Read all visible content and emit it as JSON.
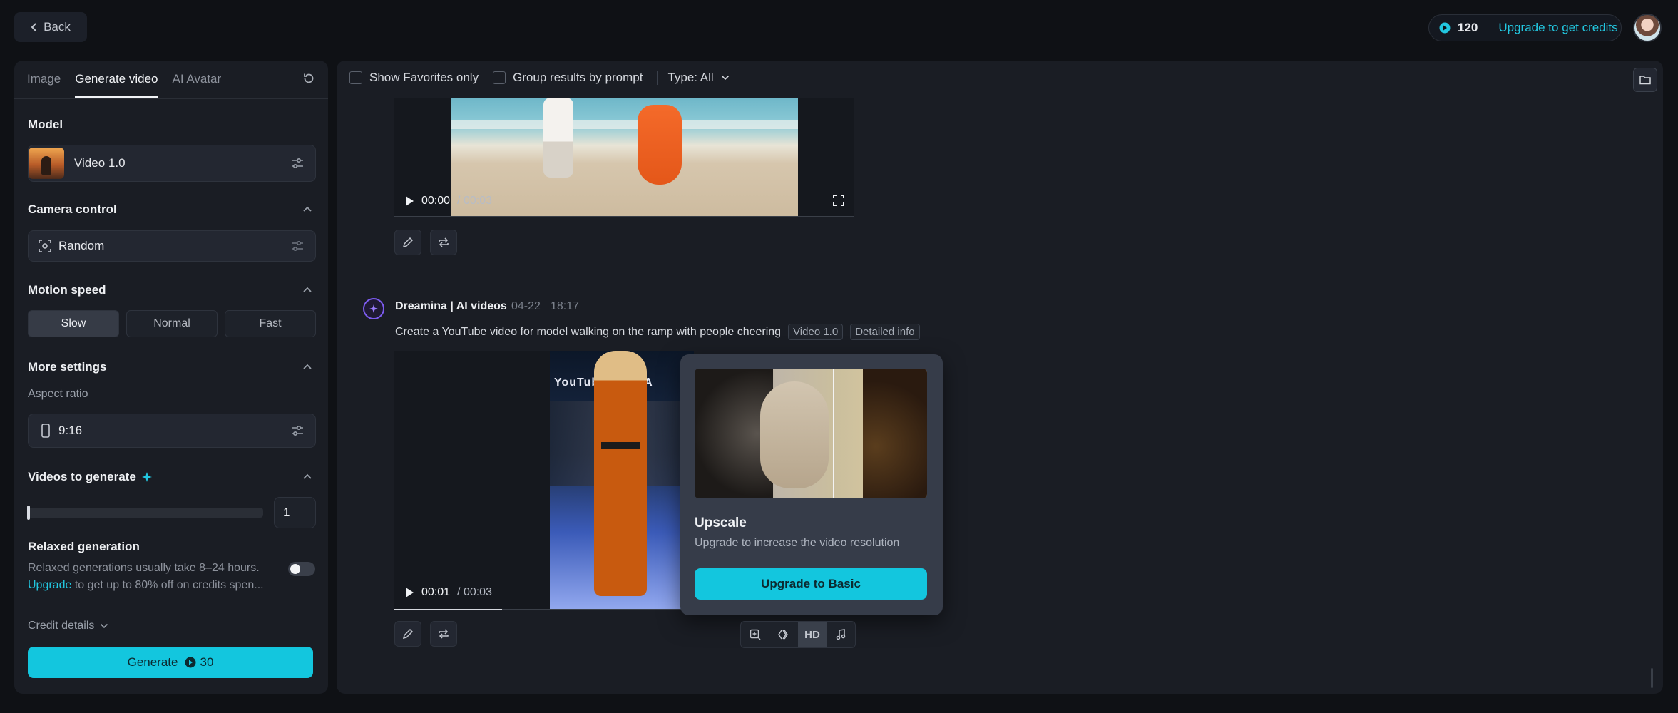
{
  "topbar": {
    "back_label": "Back",
    "credits": "120",
    "upgrade_label": "Upgrade to get credits"
  },
  "left": {
    "tabs": [
      {
        "label": "Image"
      },
      {
        "label": "Generate video"
      },
      {
        "label": "AI Avatar"
      }
    ],
    "model": {
      "title": "Model",
      "value": "Video 1.0"
    },
    "camera": {
      "title": "Camera control",
      "value": "Random"
    },
    "motion": {
      "title": "Motion speed",
      "options": [
        "Slow",
        "Normal",
        "Fast"
      ],
      "selected": "Slow"
    },
    "more": {
      "title": "More settings",
      "aspect_label": "Aspect ratio",
      "aspect_value": "9:16"
    },
    "videos": {
      "title": "Videos to generate",
      "count": "1"
    },
    "relaxed": {
      "title": "Relaxed generation",
      "desc": "Relaxed generations usually take 8–24 hours.",
      "link": "Upgrade",
      "desc2": " to get up to 80% off on credits spen..."
    },
    "credit_details": "Credit details",
    "generate": {
      "label": "Generate",
      "cost": "30"
    }
  },
  "main": {
    "filters": {
      "favorites": "Show Favorites only",
      "group": "Group results by prompt",
      "type": "Type: All"
    },
    "video1": {
      "current": "00:00",
      "total": "/ 00:03"
    },
    "entry": {
      "name": "Dreamina | AI videos",
      "date": "04-22",
      "time": "18:17",
      "prompt": "Create a YouTube video for model walking on the ramp with people cheering",
      "tag_model": "Video 1.0",
      "tag_info": "Detailed info"
    },
    "video2": {
      "current": "00:01",
      "total": "/ 00:03",
      "brand": "YouTube CLNEA"
    },
    "popup": {
      "title": "Upscale",
      "desc": "Upgrade to increase the video resolution",
      "button": "Upgrade to Basic"
    },
    "tools": {
      "hd": "HD"
    }
  },
  "colors": {
    "accent": "#13c6de",
    "panel": "#1a1d24",
    "background": "#0f1115"
  }
}
